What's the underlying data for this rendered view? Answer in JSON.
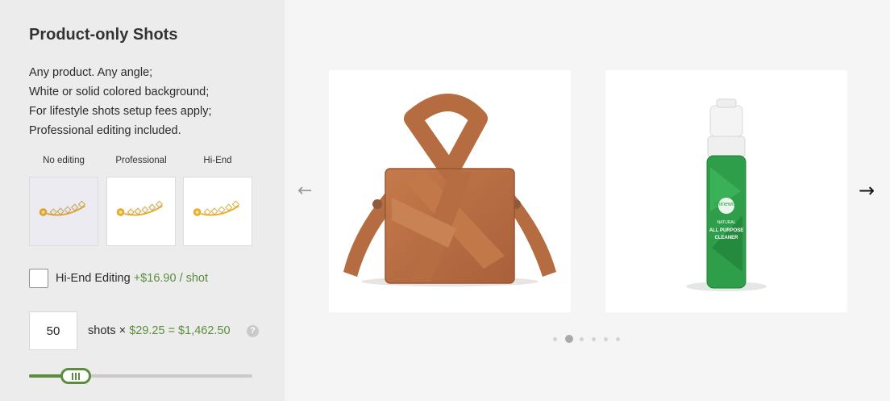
{
  "panel": {
    "title": "Product-only Shots",
    "description": [
      "Any product. Any angle;",
      "White or solid colored background;",
      "For lifestyle shots setup fees apply;",
      "Professional editing included."
    ]
  },
  "editing_samples": [
    {
      "label": "No editing"
    },
    {
      "label": "Professional"
    },
    {
      "label": "Hi-End"
    }
  ],
  "hi_end_option": {
    "label": "Hi-End Editing",
    "price": "+$16.90 / shot",
    "checked": false
  },
  "quantity": {
    "value": "50",
    "text_prefix": "shots ×",
    "price_formula": "$29.25 = $1,462.50",
    "help_icon_text": "?"
  },
  "slider": {
    "level": 0.21
  },
  "carousel": {
    "prev_icon": "←",
    "next_icon": "→",
    "slides": [
      {
        "name": "leather-handbag"
      },
      {
        "name": "cleaner-bottle",
        "bottle_text": [
          "Shinewise",
          "NATURAL",
          "ALL PURPOSE",
          "CLEANER"
        ]
      }
    ],
    "dot_count": 6,
    "active_dot": 1
  },
  "colors": {
    "accent_green": "#5b8e3c",
    "panel_bg": "#ececec",
    "page_bg": "#f5f5f5",
    "bag_brown": "#b86f42",
    "bottle_green": "#2f9e4a"
  }
}
